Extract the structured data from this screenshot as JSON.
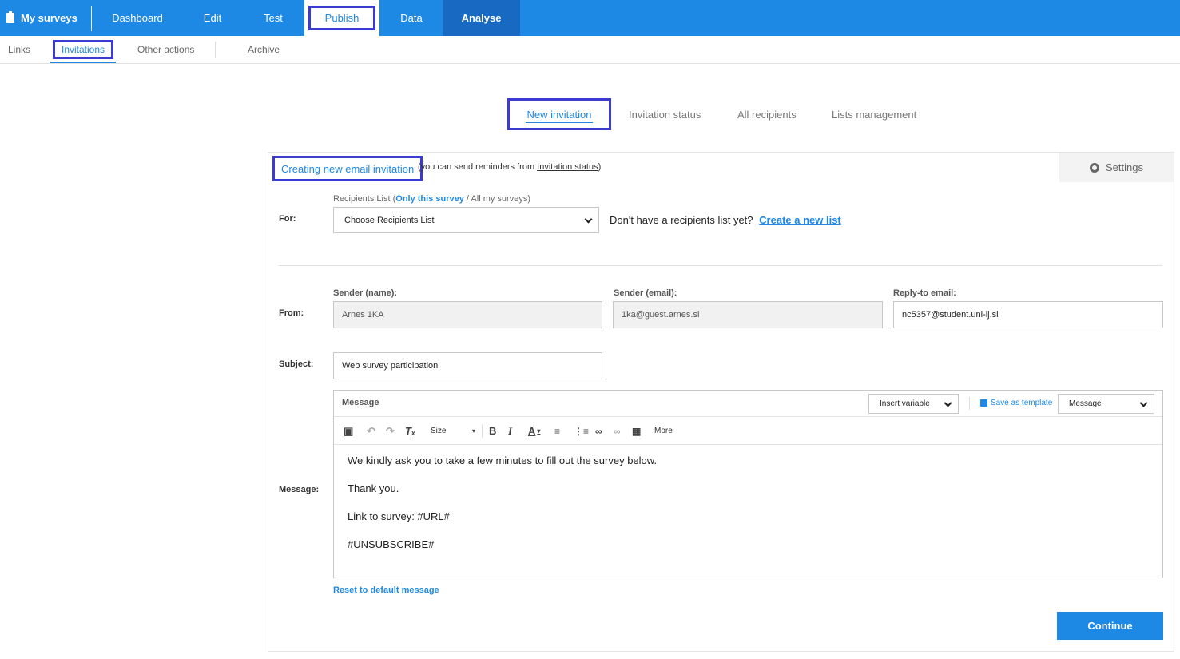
{
  "topnav": {
    "brand": "My surveys",
    "items": [
      "Dashboard",
      "Edit",
      "Test",
      "Publish",
      "Data",
      "Analyse"
    ]
  },
  "subnav": {
    "items": [
      "Links",
      "Invitations",
      "Other actions",
      "Archive"
    ]
  },
  "tabs": [
    "New invitation",
    "Invitation status",
    "All recipients",
    "Lists management"
  ],
  "panel": {
    "title": "Creating new email invitation",
    "note_prefix": "(you can send reminders from ",
    "note_link": "Invitation status",
    "note_suffix": ")",
    "settings_label": "Settings"
  },
  "for": {
    "label": "For:",
    "list_caption_prefix": "Recipients List (",
    "list_caption_active": "Only this survey",
    "list_caption_suffix": " / All my surveys)",
    "select_value": "Choose Recipients List",
    "no_list_text": "Don't have a recipients list yet?",
    "create_link": "Create a new list"
  },
  "from": {
    "label": "From:",
    "sender_name_label": "Sender (name):",
    "sender_name_value": "Arnes 1KA",
    "sender_email_label": "Sender (email):",
    "sender_email_value": "1ka@guest.arnes.si",
    "reply_to_label": "Reply-to email:",
    "reply_to_value": "nc5357@student.uni-lj.si"
  },
  "subject": {
    "label": "Subject:",
    "value": "Web survey participation"
  },
  "message": {
    "label": "Message:",
    "header_label": "Message",
    "insert_variable": "Insert variable",
    "save_template": "Save as template",
    "template_select": "Message",
    "toolbar": {
      "size_label": "Size",
      "more_label": "More"
    },
    "body": [
      "We kindly ask you to take a few minutes to fill out the survey below.",
      "Thank you.",
      "Link to survey: #URL#",
      "#UNSUBSCRIBE#"
    ],
    "reset_link": "Reset to default message"
  },
  "continue_button": "Continue",
  "colors": {
    "primary": "#1e88e5",
    "analyse_bg": "#1769c2",
    "highlight_border": "#3b3bd1"
  }
}
